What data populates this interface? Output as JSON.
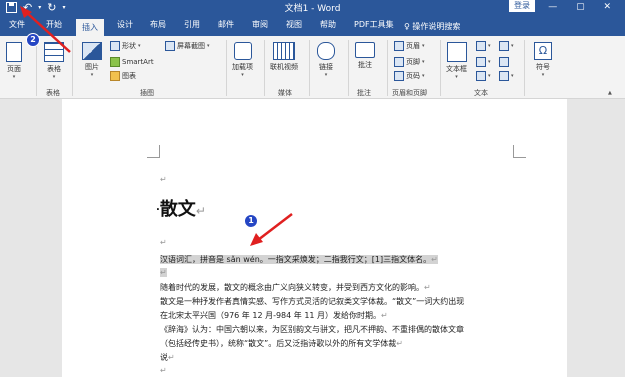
{
  "titlebar": {
    "title": "文档1 - Word",
    "login_label": "登录",
    "quick_access": [
      "save-icon",
      "undo-icon",
      "redo-icon",
      "customize-icon"
    ]
  },
  "tabs": [
    "文件",
    "开始",
    "插入",
    "设计",
    "布局",
    "引用",
    "邮件",
    "审阅",
    "视图",
    "帮助",
    "PDF工具集"
  ],
  "tell_me": "操作说明搜索",
  "ribbon": {
    "pages": {
      "label": "页面",
      "group": ""
    },
    "table": {
      "label": "表格",
      "group": "表格"
    },
    "illustrations": {
      "group": "插图",
      "picture": "图片",
      "shapes": "形状",
      "smartart": "SmartArt",
      "chart": "图表",
      "screenshot": "屏幕截图"
    },
    "addins": {
      "label": "加载项",
      "group": ""
    },
    "media": {
      "label": "联机视频",
      "group": "媒体"
    },
    "links": {
      "label": "链接",
      "group": ""
    },
    "comments": {
      "label": "批注",
      "group": "批注"
    },
    "header_footer": {
      "group": "页眉和页脚",
      "header": "页眉",
      "footer": "页脚",
      "page_number": "页码"
    },
    "text": {
      "group": "文本",
      "textbox": "文本框"
    },
    "symbols": {
      "label": "符号",
      "group": ""
    }
  },
  "document": {
    "heading": "散文",
    "paragraphs": [
      "汉语词汇，拼音是 sǎn wén。一指文采焕发；二指我行文；[1]三指文体名。",
      "随着时代的发展，散文的概念由广义向狭义转变，并受到西方文化的影响。",
      "散文是一种抒发作者真情实感、写作方式灵活的记叙类文学体裁。“散文”一词大约出现",
      "在北宋太平兴国（976 年 12 月-984 年 11 月）发给你时期。",
      "《辞海》认为：中国六朝以来，为区别韵文与骈文，把凡不押韵、不重排偶的散体文章",
      "（包括经传史书），统称“散文”。后又泛指诗歌以外的所有文学体裁",
      "说"
    ],
    "paragraph_mark": "↵"
  },
  "annotations": {
    "badge1": "1",
    "badge2": "2"
  }
}
